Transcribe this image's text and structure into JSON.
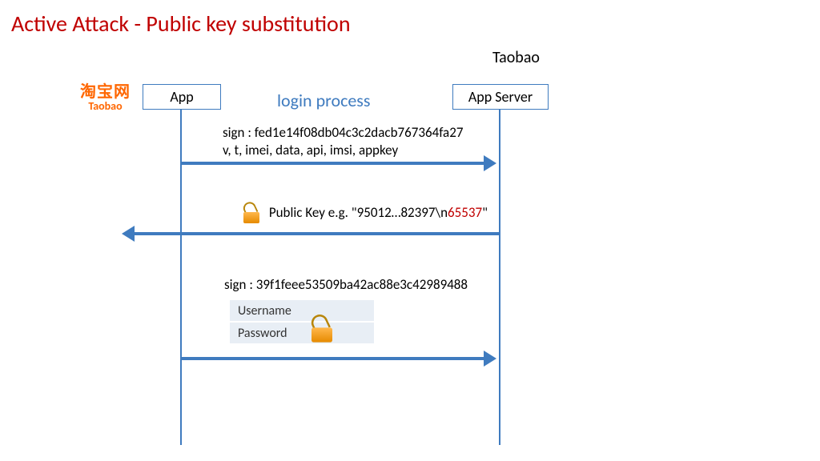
{
  "title": "Active Attack - Public key substitution",
  "top_caption": "Taobao",
  "brand": {
    "cn": "淘宝网",
    "en": "Taobao"
  },
  "participants": {
    "app": "App",
    "server": "App Server"
  },
  "center_caption": "login process",
  "msg1": {
    "line1": "sign : fed1e14f08db04c3c2dacb767364fa27",
    "line2": "v, t, imei, data, api, imsi, appkey"
  },
  "msg2": {
    "pre": "Public Key e.g. \"95012…82397\\n",
    "highlight": "65537",
    "post": "\""
  },
  "msg3": {
    "sign": "sign : 39f1feee53509ba42ac88e3c42989488",
    "field_user": "Username",
    "field_pass": "Password"
  }
}
